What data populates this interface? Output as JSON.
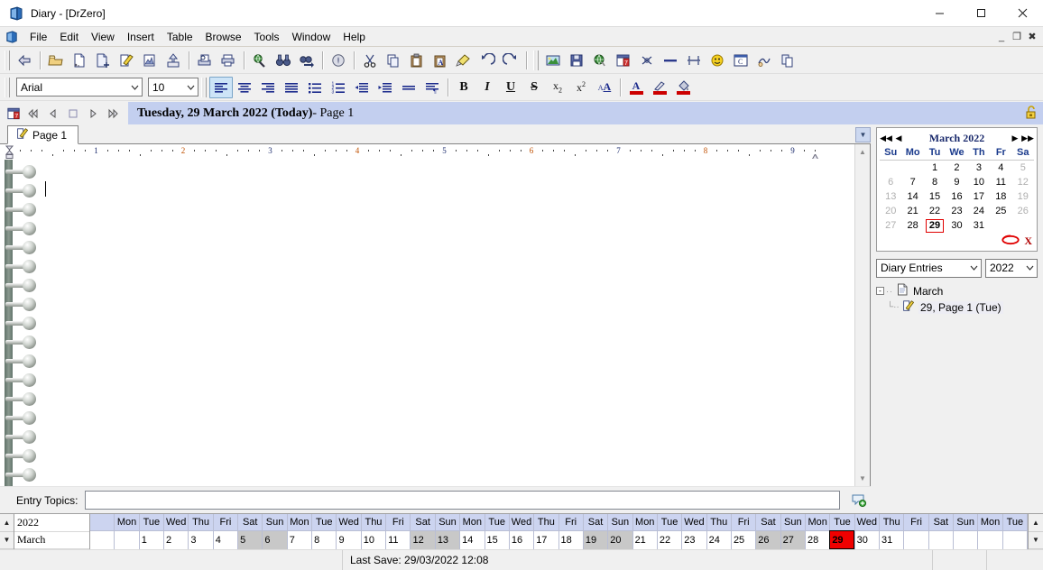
{
  "window": {
    "title": "Diary - [DrZero]",
    "app_icon": "diary-book-icon",
    "minimize": "─",
    "maximize": "☐",
    "close": "✕"
  },
  "menubar": {
    "items": [
      "File",
      "Edit",
      "View",
      "Insert",
      "Table",
      "Browse",
      "Tools",
      "Window",
      "Help"
    ],
    "mdi": {
      "minimize": "_",
      "restore": "❐",
      "close": "✖"
    }
  },
  "toolbar_main": {
    "groups": [
      {
        "buttons": [
          {
            "name": "back-icon"
          }
        ]
      },
      {
        "buttons": [
          {
            "name": "open-folder-icon"
          },
          {
            "name": "new-page-icon"
          },
          {
            "name": "add-page-icon"
          },
          {
            "name": "edit-page-icon"
          },
          {
            "name": "page-properties-icon"
          },
          {
            "name": "export-icon"
          }
        ]
      },
      {
        "buttons": [
          {
            "name": "print-preview-icon"
          },
          {
            "name": "print-icon"
          }
        ]
      },
      {
        "buttons": [
          {
            "name": "search-globe-icon"
          },
          {
            "name": "find-binoculars-icon"
          },
          {
            "name": "find-next-icon"
          }
        ]
      },
      {
        "buttons": [
          {
            "name": "info-icon"
          }
        ]
      },
      {
        "buttons": [
          {
            "name": "cut-icon"
          },
          {
            "name": "copy-icon"
          },
          {
            "name": "paste-icon"
          },
          {
            "name": "paste-special-icon"
          },
          {
            "name": "format-painter-icon"
          },
          {
            "name": "undo-icon"
          },
          {
            "name": "redo-icon"
          }
        ]
      },
      {
        "buttons": [
          {
            "name": "insert-picture-icon"
          },
          {
            "name": "insert-object-icon"
          },
          {
            "name": "insert-hyperlink-icon"
          },
          {
            "name": "insert-date-icon"
          },
          {
            "name": "insert-symbol-icon"
          },
          {
            "name": "horizontal-line-icon"
          },
          {
            "name": "page-break-icon"
          },
          {
            "name": "smiley-icon"
          },
          {
            "name": "insert-textbox-icon"
          },
          {
            "name": "insert-signature-icon"
          },
          {
            "name": "duplicate-icon"
          }
        ]
      }
    ]
  },
  "toolbar_format": {
    "font": {
      "value": "Arial",
      "placeholder": "Font"
    },
    "size": {
      "value": "10",
      "placeholder": "Size"
    },
    "paragraph_buttons": [
      {
        "name": "align-left-icon",
        "active": true
      },
      {
        "name": "align-center-icon",
        "active": false
      },
      {
        "name": "align-right-icon",
        "active": false
      },
      {
        "name": "align-justify-icon",
        "active": false
      },
      {
        "name": "bullet-list-icon",
        "active": false
      },
      {
        "name": "numbered-list-icon",
        "active": false
      },
      {
        "name": "decrease-indent-icon",
        "active": false
      },
      {
        "name": "increase-indent-icon",
        "active": false
      },
      {
        "name": "line-spacing-icon",
        "active": false
      },
      {
        "name": "paragraph-marks-icon",
        "active": false
      }
    ],
    "character_buttons": [
      {
        "name": "bold-icon",
        "glyph": "B"
      },
      {
        "name": "italic-icon",
        "glyph": "I"
      },
      {
        "name": "underline-icon",
        "glyph": "U"
      },
      {
        "name": "strikethrough-icon",
        "glyph": "S"
      },
      {
        "name": "subscript-icon",
        "glyph": "x₂"
      },
      {
        "name": "superscript-icon",
        "glyph": "x²"
      },
      {
        "name": "font-style-icon",
        "glyph": "A"
      }
    ],
    "color_buttons": [
      {
        "name": "font-color-icon",
        "glyph": "A",
        "color": "#cc0000"
      },
      {
        "name": "highlight-color-icon",
        "glyph": "✎",
        "color": "#cc0000"
      },
      {
        "name": "fill-color-icon",
        "glyph": "◢",
        "color": "#cc0000"
      }
    ]
  },
  "datebar": {
    "calendar_icon": "calendar-icon",
    "nav": [
      {
        "name": "first-page-button",
        "glyph": "◀◀"
      },
      {
        "name": "previous-page-button",
        "glyph": "◁"
      },
      {
        "name": "stop-button",
        "glyph": "□"
      },
      {
        "name": "next-page-button",
        "glyph": "▷"
      },
      {
        "name": "last-page-button",
        "glyph": "▶▶"
      }
    ],
    "title_main": "Tuesday, 29 March 2022 (Today)",
    "title_sub": " - Page 1",
    "lock_icon": "unlocked-padlock-icon"
  },
  "tabs": {
    "items": [
      {
        "label": "Page 1",
        "icon": "page-edit-icon",
        "active": true
      }
    ],
    "dropdown_glyph": "▼"
  },
  "ruler": {
    "numbers": [
      "1",
      "2",
      "3",
      "4",
      "5",
      "6",
      "7",
      "8",
      "9"
    ]
  },
  "editor": {
    "content": "",
    "scroll_up_glyph": "▲",
    "scroll_down_glyph": "▼"
  },
  "entry_topics": {
    "label": "Entry Topics:",
    "value": "",
    "placeholder": "",
    "add_icon": "add-topic-icon"
  },
  "calendar": {
    "title": "March 2022",
    "nav": {
      "prev_year": "◀◀",
      "prev_month": "◀",
      "next_month": "▶",
      "next_year": "▶▶"
    },
    "weekdays": [
      "Su",
      "Mo",
      "Tu",
      "We",
      "Th",
      "Fr",
      "Sa"
    ],
    "weeks": [
      [
        {
          "d": "",
          "dim": false
        },
        {
          "d": "",
          "dim": false
        },
        {
          "d": "1",
          "dim": false
        },
        {
          "d": "2",
          "dim": false
        },
        {
          "d": "3",
          "dim": false
        },
        {
          "d": "4",
          "dim": false
        },
        {
          "d": "5",
          "dim": true
        }
      ],
      [
        {
          "d": "6",
          "dim": true
        },
        {
          "d": "7",
          "dim": false
        },
        {
          "d": "8",
          "dim": false
        },
        {
          "d": "9",
          "dim": false
        },
        {
          "d": "10",
          "dim": false
        },
        {
          "d": "11",
          "dim": false
        },
        {
          "d": "12",
          "dim": true
        }
      ],
      [
        {
          "d": "13",
          "dim": true
        },
        {
          "d": "14",
          "dim": false
        },
        {
          "d": "15",
          "dim": false
        },
        {
          "d": "16",
          "dim": false
        },
        {
          "d": "17",
          "dim": false
        },
        {
          "d": "18",
          "dim": false
        },
        {
          "d": "19",
          "dim": true
        }
      ],
      [
        {
          "d": "20",
          "dim": true
        },
        {
          "d": "21",
          "dim": false
        },
        {
          "d": "22",
          "dim": false
        },
        {
          "d": "23",
          "dim": false
        },
        {
          "d": "24",
          "dim": false
        },
        {
          "d": "25",
          "dim": false
        },
        {
          "d": "26",
          "dim": true
        }
      ],
      [
        {
          "d": "27",
          "dim": true
        },
        {
          "d": "28",
          "dim": false
        },
        {
          "d": "29",
          "dim": false,
          "selected": true
        },
        {
          "d": "30",
          "dim": false
        },
        {
          "d": "31",
          "dim": false
        },
        {
          "d": "",
          "dim": false
        },
        {
          "d": "",
          "dim": false
        }
      ]
    ],
    "selected_day": "29",
    "today_button": "today-ellipse-icon",
    "clear_button": "X",
    "selection_color": "#e00000"
  },
  "browser": {
    "view_combo": {
      "value": "Diary Entries",
      "placeholder": "View"
    },
    "year_combo": {
      "value": "2022",
      "placeholder": "Year"
    },
    "tree": {
      "root": {
        "label": "March",
        "icon": "document-icon",
        "expander": "-"
      },
      "children": [
        {
          "label": "29, Page 1 (Tue)",
          "icon": "page-edit-icon",
          "selected": true
        }
      ]
    }
  },
  "timeline": {
    "year": "2022",
    "month": "March",
    "spin_up": "▲",
    "spin_down": "▼",
    "scroll_up": "▲",
    "scroll_down": "▼",
    "columns": [
      {
        "weekday": "",
        "day": "",
        "weekend": false
      },
      {
        "weekday": "Mon",
        "day": "",
        "weekend": false
      },
      {
        "weekday": "Tue",
        "day": "1",
        "weekend": false
      },
      {
        "weekday": "Wed",
        "day": "2",
        "weekend": false
      },
      {
        "weekday": "Thu",
        "day": "3",
        "weekend": false
      },
      {
        "weekday": "Fri",
        "day": "4",
        "weekend": false
      },
      {
        "weekday": "Sat",
        "day": "5",
        "weekend": true
      },
      {
        "weekday": "Sun",
        "day": "6",
        "weekend": true
      },
      {
        "weekday": "Mon",
        "day": "7",
        "weekend": false
      },
      {
        "weekday": "Tue",
        "day": "8",
        "weekend": false
      },
      {
        "weekday": "Wed",
        "day": "9",
        "weekend": false
      },
      {
        "weekday": "Thu",
        "day": "10",
        "weekend": false
      },
      {
        "weekday": "Fri",
        "day": "11",
        "weekend": false
      },
      {
        "weekday": "Sat",
        "day": "12",
        "weekend": true
      },
      {
        "weekday": "Sun",
        "day": "13",
        "weekend": true
      },
      {
        "weekday": "Mon",
        "day": "14",
        "weekend": false
      },
      {
        "weekday": "Tue",
        "day": "15",
        "weekend": false
      },
      {
        "weekday": "Wed",
        "day": "16",
        "weekend": false
      },
      {
        "weekday": "Thu",
        "day": "17",
        "weekend": false
      },
      {
        "weekday": "Fri",
        "day": "18",
        "weekend": false
      },
      {
        "weekday": "Sat",
        "day": "19",
        "weekend": true
      },
      {
        "weekday": "Sun",
        "day": "20",
        "weekend": true
      },
      {
        "weekday": "Mon",
        "day": "21",
        "weekend": false
      },
      {
        "weekday": "Tue",
        "day": "22",
        "weekend": false
      },
      {
        "weekday": "Wed",
        "day": "23",
        "weekend": false
      },
      {
        "weekday": "Thu",
        "day": "24",
        "weekend": false
      },
      {
        "weekday": "Fri",
        "day": "25",
        "weekend": false
      },
      {
        "weekday": "Sat",
        "day": "26",
        "weekend": true
      },
      {
        "weekday": "Sun",
        "day": "27",
        "weekend": true
      },
      {
        "weekday": "Mon",
        "day": "28",
        "weekend": false
      },
      {
        "weekday": "Tue",
        "day": "29",
        "weekend": false,
        "today": true
      },
      {
        "weekday": "Wed",
        "day": "30",
        "weekend": false
      },
      {
        "weekday": "Thu",
        "day": "31",
        "weekend": false
      },
      {
        "weekday": "Fri",
        "day": "",
        "weekend": false
      },
      {
        "weekday": "Sat",
        "day": "",
        "weekend": false
      },
      {
        "weekday": "Sun",
        "day": "",
        "weekend": false
      },
      {
        "weekday": "Mon",
        "day": "",
        "weekend": false
      },
      {
        "weekday": "Tue",
        "day": "",
        "weekend": false
      }
    ],
    "today_color": "#f00000"
  },
  "statusbar": {
    "last_save": "Last Save: 29/03/2022 12:08"
  }
}
